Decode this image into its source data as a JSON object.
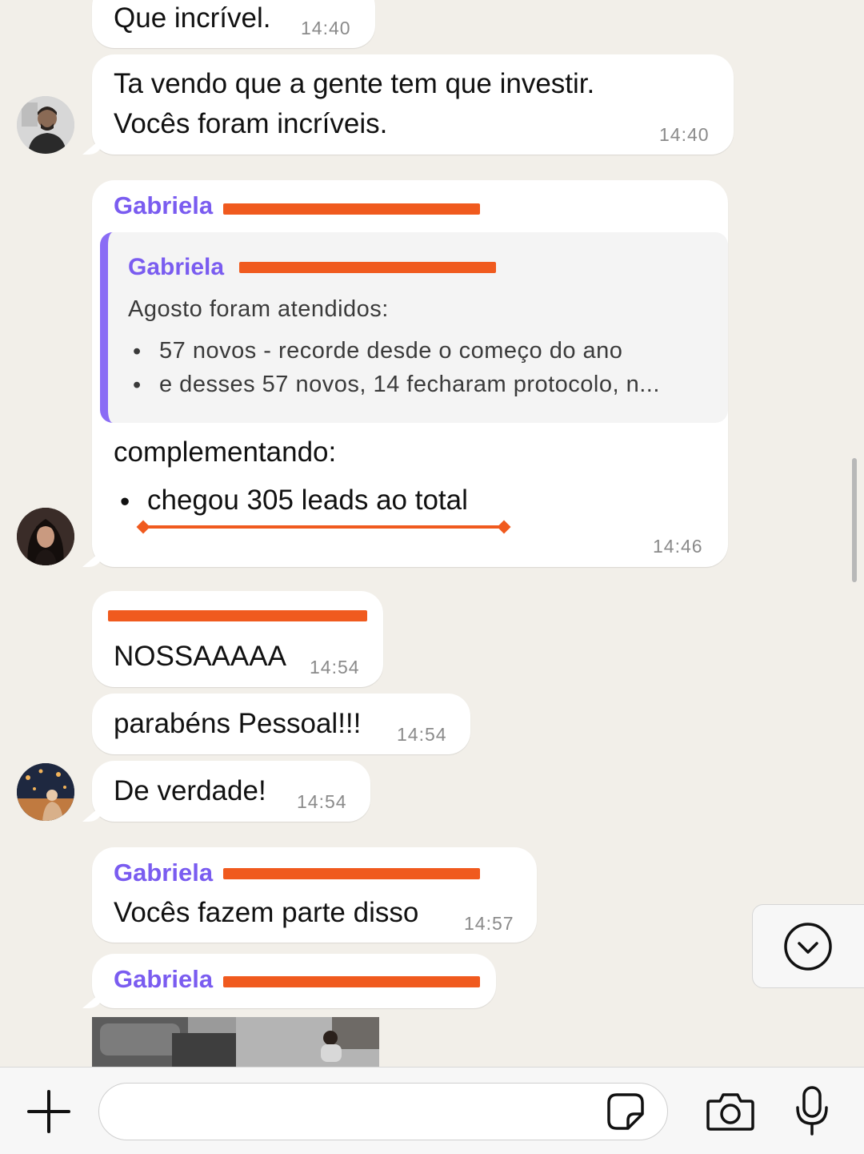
{
  "messages": [
    {
      "text": "Que incrível.",
      "time": "14:40"
    },
    {
      "line1": "Ta vendo que a gente tem que investir.",
      "line2": "Vocês foram incríveis.",
      "time": "14:40"
    },
    {
      "sender": "Gabriela",
      "quote": {
        "sender": "Gabriela",
        "text": "Agosto foram atendidos:",
        "bullets": [
          "57 novos - recorde desde o começo do ano",
          "e desses 57 novos, 14 fecharam protocolo, n..."
        ]
      },
      "text": "complementando:",
      "bullet": "chegou 305 leads ao total",
      "time": "14:46"
    },
    {
      "text": "NOSSAAAAA",
      "time": "14:54"
    },
    {
      "text": "parabéns Pessoal!!!",
      "time": "14:54"
    },
    {
      "text": "De verdade!",
      "time": "14:54"
    },
    {
      "sender": "Gabriela",
      "text": "Vocês fazem parte disso",
      "time": "14:57"
    },
    {
      "sender": "Gabriela"
    }
  ],
  "colors": {
    "background": "#F2EFE9",
    "sender": "#7A5CF0",
    "redaction": "#F05A1E",
    "quote_bar": "#8A6CF5"
  },
  "icons": {
    "add": "plus-icon",
    "sticker": "sticker-icon",
    "camera": "camera-icon",
    "mic": "microphone-icon",
    "scroll": "chevron-down-circle-icon"
  }
}
